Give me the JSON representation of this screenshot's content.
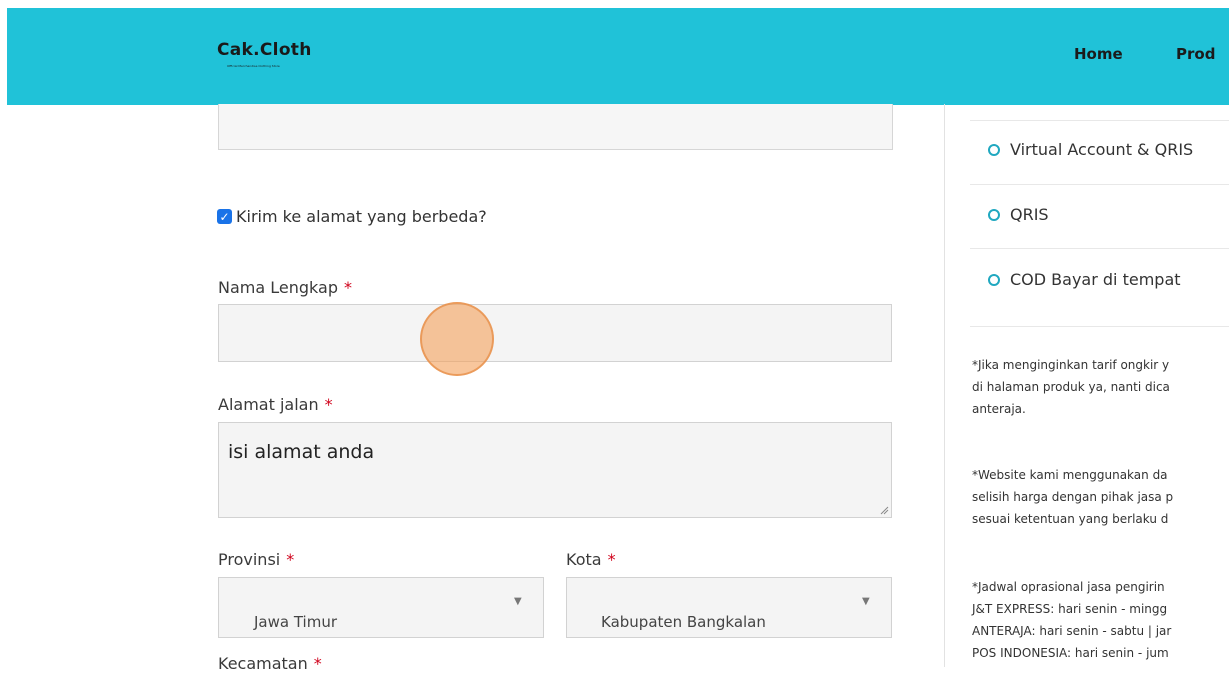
{
  "header": {
    "logo_text": "Cak.Cloth",
    "logo_tagline": "Official Merchandise Clothing Store",
    "nav": [
      "Home",
      "Prod"
    ]
  },
  "form": {
    "ship_different_label": "Kirim ke alamat yang berbeda?",
    "ship_different_checked": true,
    "full_name_label": "Nama Lengkap",
    "full_name_value": "",
    "street_label": "Alamat jalan",
    "street_value": "isi alamat anda",
    "province_label": "Provinsi",
    "province_value": "Jawa Timur",
    "city_label": "Kota",
    "city_value": "Kabupaten Bangkalan",
    "district_label": "Kecamatan",
    "required_mark": "*"
  },
  "payment": {
    "options": [
      "Virtual Account & QRIS",
      "QRIS",
      "COD Bayar di tempat"
    ]
  },
  "notes": {
    "note1": [
      "*Jika menginginkan tarif ongkir y",
      "di halaman produk ya, nanti dica",
      "anteraja."
    ],
    "note2": [
      "*Website kami menggunakan da",
      "selisih harga dengan pihak jasa p",
      "sesuai ketentuan yang berlaku d"
    ],
    "note3": [
      "*Jadwal oprasional jasa pengirin",
      "J&T EXPRESS: hari senin - mingg",
      "ANTERAJA: hari senin - sabtu | jar",
      "POS INDONESIA: hari senin - jum"
    ]
  },
  "colors": {
    "header_bg": "#20c2d8",
    "checkbox": "#1a73e8",
    "radio": "#20a8c0",
    "required": "#d0021b"
  }
}
